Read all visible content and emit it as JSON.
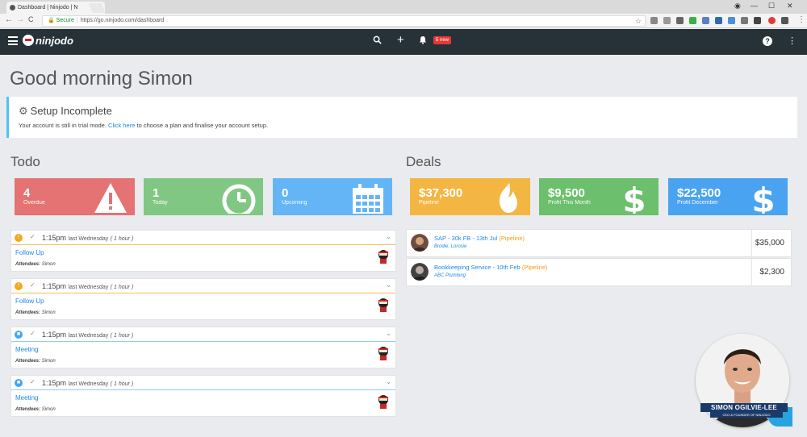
{
  "browser": {
    "tab_title": "Dashboard | Ninjodo | N",
    "tab_close": "×",
    "back": "←",
    "forward": "→",
    "reload": "C",
    "secure_label": "Secure",
    "url": "https://go.ninjodo.com/dashboard",
    "star": "☆",
    "account_icon": "◉",
    "minimize": "—",
    "maximize": "☐",
    "close": "✕"
  },
  "app": {
    "logo_text": "ninjodo",
    "new_badge": "5 new",
    "help": "?",
    "more": "⋮",
    "search_icon": "⚲",
    "add_icon": "+",
    "bell_icon": "🔔"
  },
  "greeting": "Good morning Simon",
  "setup": {
    "title": "Setup Incomplete",
    "gear": "⚙",
    "msg_before": "Your account is still in trial mode.",
    "link": "Click here",
    "msg_after": "to choose a plan and finalise your account setup."
  },
  "todo": {
    "title": "Todo",
    "tiles": [
      {
        "num": "4",
        "label": "Overdue",
        "color": "#e57373"
      },
      {
        "num": "1",
        "label": "Today",
        "color": "#81c784"
      },
      {
        "num": "0",
        "label": "Upcoming",
        "color": "#64b5f6"
      }
    ],
    "items": [
      {
        "icon": "!",
        "time": "1:15pm",
        "when": "last Wednesday",
        "dur": "( 1 hour )",
        "title": "Follow Up",
        "att_label": "Attendees:",
        "att": "Simon",
        "type": "followup"
      },
      {
        "icon": "!",
        "time": "1:15pm",
        "when": "last Wednesday",
        "dur": "( 1 hour )",
        "title": "Follow Up",
        "att_label": "Attendees:",
        "att": "Simon",
        "type": "followup"
      },
      {
        "icon": "■",
        "time": "1:15pm",
        "when": "last Wednesday",
        "dur": "( 1 hour )",
        "title": "Meeting",
        "att_label": "Attendees:",
        "att": "Simon",
        "type": "meeting"
      },
      {
        "icon": "■",
        "time": "1:15pm",
        "when": "last Wednesday",
        "dur": "( 1 hour )",
        "title": "Meeting",
        "att_label": "Attendees:",
        "att": "Simon",
        "type": "meeting"
      }
    ],
    "check": "✓",
    "chevron": "⌄"
  },
  "deals": {
    "title": "Deals",
    "tiles": [
      {
        "num": "$37,300",
        "label": "Pipeline",
        "color": "#f4b642"
      },
      {
        "num": "$9,500",
        "label": "Profit This Month",
        "color": "#6cbf6c"
      },
      {
        "num": "$22,500",
        "label": "Profit December",
        "color": "#4aa3f0"
      }
    ],
    "items": [
      {
        "title": "SAP - 30k FB - 13th Jul",
        "status": "(Pipeline)",
        "sub": "Brodie, Lorosie",
        "amount": "$35,000"
      },
      {
        "title": "Bookkeeping Service - 10th Feb",
        "status": "(Pipeline)",
        "sub": "ABC Plumbing",
        "amount": "$2,300"
      }
    ]
  },
  "presenter": {
    "name": "SIMON OGILVIE-LEE",
    "role": "CEO & FOUNDER OF NINJODO"
  }
}
